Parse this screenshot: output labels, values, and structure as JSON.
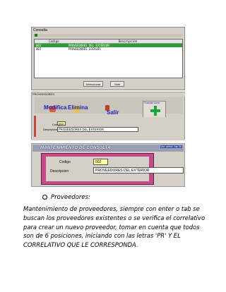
{
  "consulta": {
    "title": "Consulta",
    "col_code": "Codigo",
    "col_desc": "Descripcion",
    "rows": [
      {
        "code": "002",
        "desc": "PROVEEDORES DEL EXTERIOR",
        "selected": true
      },
      {
        "code": "001",
        "desc": "PROVEEDORES LOCALES",
        "selected": false
      }
    ],
    "select_label": "Seleccionar",
    "exit_label": "Salir"
  },
  "proveedores": {
    "title": "PROVEEDORES",
    "modify_label": "Modifica",
    "delete_label": "Elimina",
    "exit_label": "Salir",
    "new_tooltip": "Guardar como",
    "code_label": "Codigo",
    "code_value": "002",
    "desc_label": "Descripcion",
    "desc_value": "PROVEEDORES DEL EXTERIOR"
  },
  "mantenimiento": {
    "title": "MANTENIMIENTO DE CONSULTA",
    "user_info": "Usr: admin, Jan 30",
    "code_label": "Codigo",
    "code_value": "002",
    "desc_label": "Descripcion",
    "desc_value": "PROVEEDORES DEL EXTERIOR"
  },
  "doc": {
    "bullet": "Proveedores:",
    "paragraph": "Mantenimiento de proveedores, siempre con enter o tab se buscan los proveedores existentes o se verifica el correlativo para crear un nuevo proveedor, tomar en cuenta que todos son de 6 posiciones, iniciando con las letras 'PR' Y EL CORRELATIVO QUE LE CORRESPONDA."
  },
  "colors": {
    "selected_row": "#2f9b36",
    "toolbar_text": "#1a23b8",
    "pink_frame": "#c44a8a",
    "yellow_field": "#fff9a6"
  }
}
